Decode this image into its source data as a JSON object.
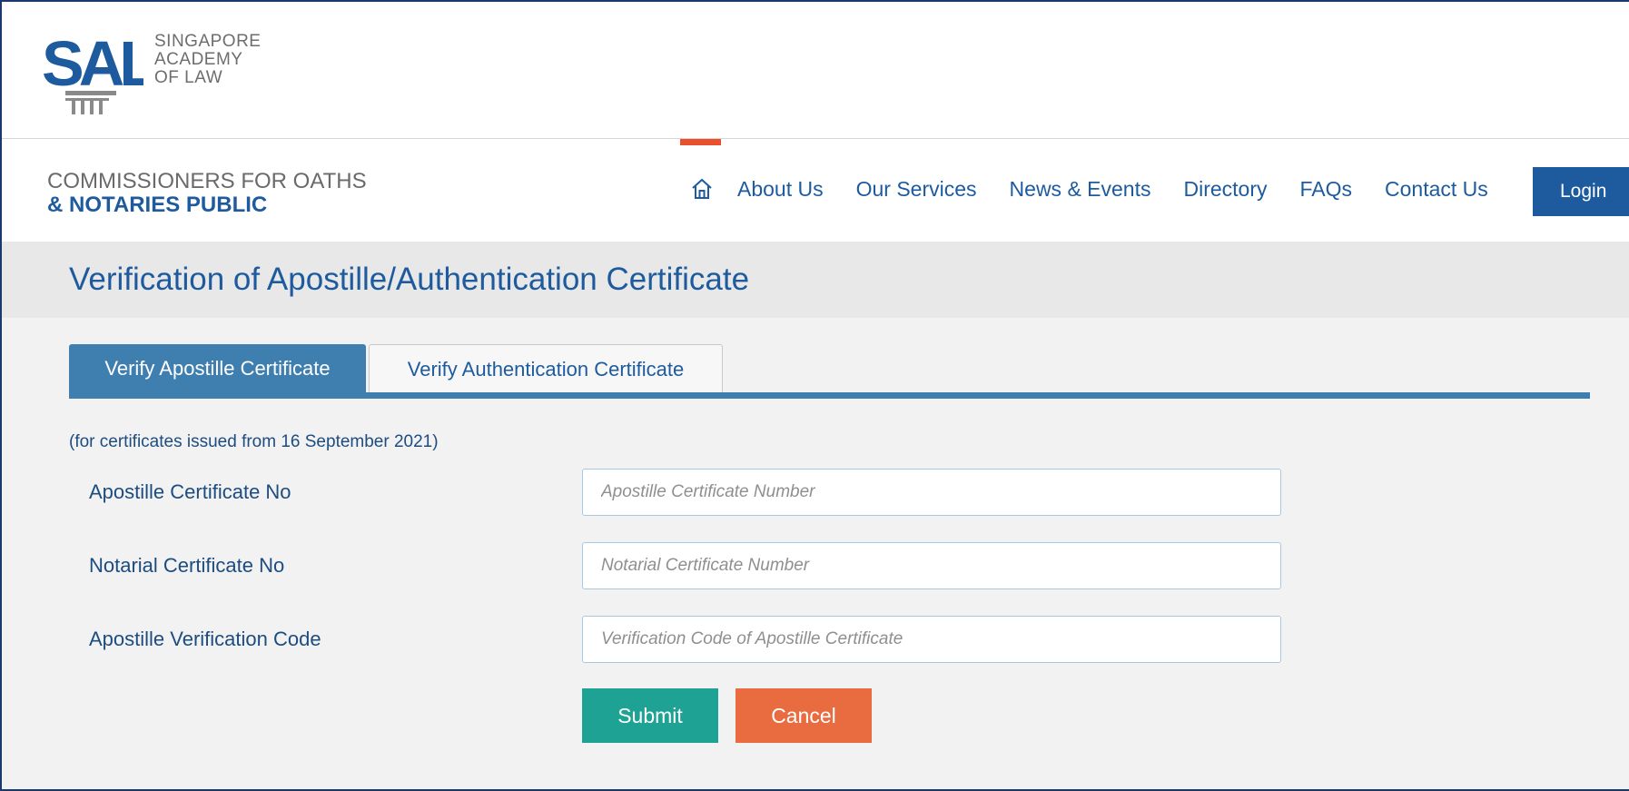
{
  "header": {
    "logo_mark": "SAL",
    "logo_lines": [
      "SINGAPORE",
      "ACADEMY",
      "OF LAW"
    ],
    "product_line1": "COMMISSIONERS FOR OATHS",
    "product_line2": "& NOTARIES PUBLIC"
  },
  "nav": {
    "home_icon": "home-icon",
    "items": [
      "About Us",
      "Our Services",
      "News & Events",
      "Directory",
      "FAQs",
      "Contact Us"
    ],
    "login_label": "Login"
  },
  "page": {
    "title": "Verification of Apostille/Authentication Certificate"
  },
  "tabs": [
    {
      "label": "Verify Apostille Certificate",
      "active": true
    },
    {
      "label": "Verify Authentication Certificate",
      "active": false
    }
  ],
  "form": {
    "note": "(for certificates issued from 16 September 2021)",
    "fields": [
      {
        "label": "Apostille Certificate No",
        "placeholder": "Apostille Certificate Number",
        "value": ""
      },
      {
        "label": "Notarial Certificate No",
        "placeholder": "Notarial Certificate Number",
        "value": ""
      },
      {
        "label": "Apostille Verification Code",
        "placeholder": "Verification Code of Apostille Certificate",
        "value": ""
      }
    ],
    "submit_label": "Submit",
    "cancel_label": "Cancel"
  },
  "colors": {
    "brand_blue": "#1d5b9e",
    "tab_blue": "#3f7fb0",
    "accent_orange": "#e8502e",
    "submit_teal": "#1ea293",
    "cancel_orange": "#e86c40"
  }
}
